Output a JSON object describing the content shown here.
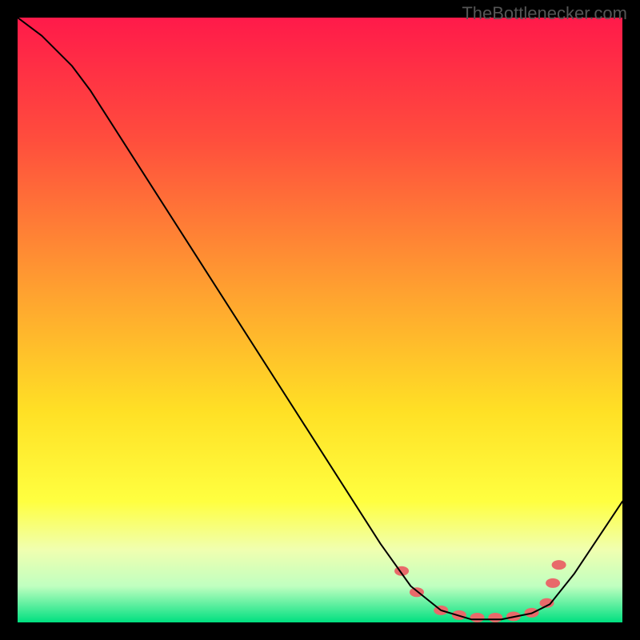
{
  "watermark": "TheBottlenecker.com",
  "chart_data": {
    "type": "line",
    "title": "",
    "xlabel": "",
    "ylabel": "",
    "xlim": [
      0,
      100
    ],
    "ylim": [
      0,
      100
    ],
    "background_gradient": {
      "type": "vertical",
      "stops": [
        {
          "pos": 0.0,
          "color": "#ff1a4a"
        },
        {
          "pos": 0.2,
          "color": "#ff4d3d"
        },
        {
          "pos": 0.45,
          "color": "#ffa030"
        },
        {
          "pos": 0.65,
          "color": "#ffe025"
        },
        {
          "pos": 0.8,
          "color": "#ffff40"
        },
        {
          "pos": 0.88,
          "color": "#f0ffb0"
        },
        {
          "pos": 0.94,
          "color": "#c0ffc0"
        },
        {
          "pos": 1.0,
          "color": "#00e080"
        }
      ]
    },
    "series": [
      {
        "name": "curve",
        "stroke": "#000000",
        "stroke_width": 2,
        "points": [
          {
            "x": 0,
            "y": 100
          },
          {
            "x": 4,
            "y": 97
          },
          {
            "x": 9,
            "y": 92
          },
          {
            "x": 12,
            "y": 88
          },
          {
            "x": 60,
            "y": 13
          },
          {
            "x": 65,
            "y": 6
          },
          {
            "x": 70,
            "y": 2
          },
          {
            "x": 75,
            "y": 0.5
          },
          {
            "x": 80,
            "y": 0.5
          },
          {
            "x": 85,
            "y": 1.5
          },
          {
            "x": 88,
            "y": 3
          },
          {
            "x": 92,
            "y": 8
          },
          {
            "x": 100,
            "y": 20
          }
        ]
      }
    ],
    "markers": {
      "color": "#e86a6a",
      "shape": "ellipse",
      "rx": 9,
      "ry": 6,
      "points": [
        {
          "x": 63.5,
          "y": 8.5
        },
        {
          "x": 66,
          "y": 5
        },
        {
          "x": 70,
          "y": 2
        },
        {
          "x": 73,
          "y": 1.2
        },
        {
          "x": 76,
          "y": 0.8
        },
        {
          "x": 79,
          "y": 0.8
        },
        {
          "x": 82,
          "y": 1.0
        },
        {
          "x": 85,
          "y": 1.6
        },
        {
          "x": 87.5,
          "y": 3.2
        },
        {
          "x": 88.5,
          "y": 6.5
        },
        {
          "x": 89.5,
          "y": 9.5
        }
      ]
    }
  }
}
